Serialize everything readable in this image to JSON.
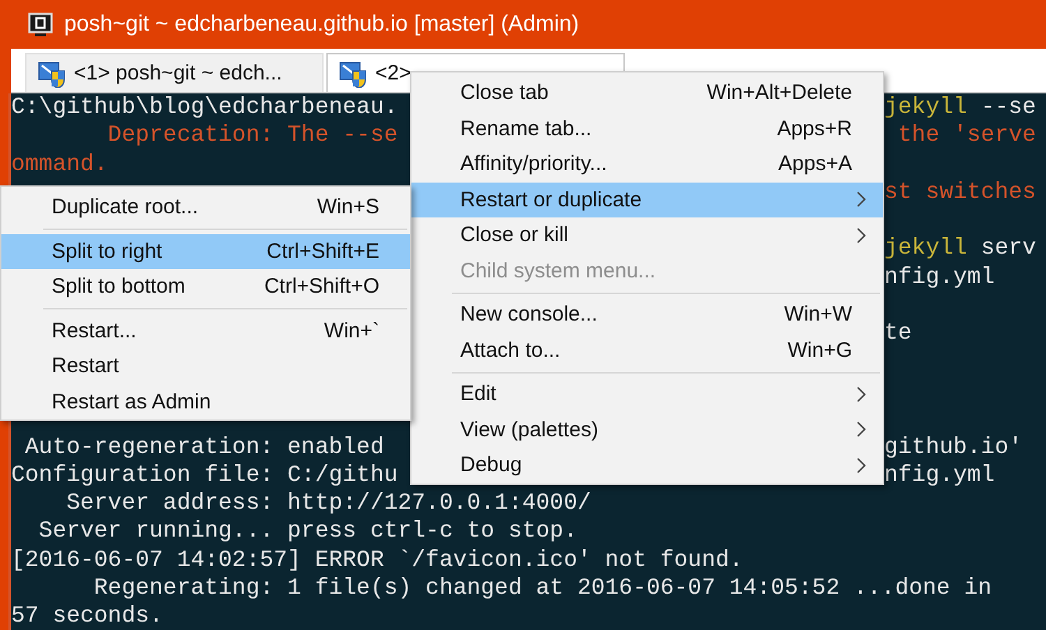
{
  "window": {
    "title": "posh~git ~ edcharbeneau.github.io [master] (Admin)"
  },
  "tabs": [
    {
      "label": "<1> posh~git ~ edch...",
      "selected": false
    },
    {
      "label": "<2>",
      "selected": true
    }
  ],
  "terminal": {
    "lines": [
      {
        "kind": "text",
        "left": [
          {
            "text": "C:\\github\\blog\\edcharbeneau.",
            "kind": "plain"
          }
        ],
        "right": [
          {
            "text": "jekyll",
            "kind": "command"
          },
          {
            "text": " --se",
            "kind": "plain"
          }
        ]
      },
      {
        "kind": "text",
        "left": [
          {
            "text": "       Deprecation: The --se",
            "kind": "warning"
          }
        ],
        "right": [
          {
            "text": " the 'serve",
            "kind": "warning"
          }
        ]
      },
      {
        "kind": "text",
        "left": [
          {
            "text": "ommand.",
            "kind": "warning"
          }
        ]
      },
      {
        "kind": "text",
        "right": [
          {
            "text": "st switches",
            "kind": "warning"
          }
        ]
      },
      {
        "kind": "blank"
      },
      {
        "kind": "text",
        "right": [
          {
            "text": "jekyll",
            "kind": "command"
          },
          {
            "text": " serv",
            "kind": "plain"
          }
        ]
      },
      {
        "kind": "text",
        "right": [
          {
            "text": "nfig.yml",
            "kind": "plain"
          }
        ]
      },
      {
        "kind": "blank"
      },
      {
        "kind": "text",
        "right": [
          {
            "text": "te",
            "kind": "plain"
          }
        ]
      },
      {
        "kind": "blank"
      },
      {
        "kind": "blank"
      },
      {
        "kind": "blank"
      },
      {
        "kind": "text",
        "left": [
          {
            "text": " Auto-regeneration: enabled",
            "kind": "plain"
          }
        ],
        "right": [
          {
            "text": "github.io'",
            "kind": "plain"
          }
        ]
      },
      {
        "kind": "text",
        "left": [
          {
            "text": "Configuration file: C:/githu",
            "kind": "plain"
          }
        ],
        "right": [
          {
            "text": "nfig.yml",
            "kind": "plain"
          }
        ]
      },
      {
        "kind": "text",
        "left": [
          {
            "text": "    Server address: http://127.0.0.1:4000/",
            "kind": "plain"
          }
        ]
      },
      {
        "kind": "text",
        "left": [
          {
            "text": "  Server running... press ctrl-c to stop.",
            "kind": "plain"
          }
        ]
      },
      {
        "kind": "text",
        "left": [
          {
            "text": "[2016-06-07 14:02:57] ERROR `/favicon.ico' not found.",
            "kind": "plain"
          }
        ]
      },
      {
        "kind": "text",
        "left": [
          {
            "text": "      Regenerating: 1 file(s) changed at 2016-06-07 14:05:52 ...done in",
            "kind": "plain"
          }
        ]
      },
      {
        "kind": "text",
        "left": [
          {
            "text": "57 seconds.",
            "kind": "plain"
          }
        ]
      }
    ]
  },
  "context_menu": {
    "items": [
      {
        "kind": "item",
        "label": "Close tab",
        "shortcut": "Win+Alt+Delete",
        "selected": false,
        "disabled": false
      },
      {
        "kind": "item",
        "label": "Rename tab...",
        "shortcut": "Apps+R",
        "selected": false,
        "disabled": false
      },
      {
        "kind": "item",
        "label": "Affinity/priority...",
        "shortcut": "Apps+A",
        "selected": false,
        "disabled": false
      },
      {
        "kind": "submenu",
        "label": "Restart or duplicate",
        "selected": true,
        "disabled": false
      },
      {
        "kind": "submenu",
        "label": "Close or kill",
        "selected": false,
        "disabled": false
      },
      {
        "kind": "item",
        "label": "Child system menu...",
        "selected": false,
        "disabled": true
      },
      {
        "kind": "separator"
      },
      {
        "kind": "item",
        "label": "New console...",
        "shortcut": "Win+W",
        "selected": false,
        "disabled": false
      },
      {
        "kind": "item",
        "label": "Attach to...",
        "shortcut": "Win+G",
        "selected": false,
        "disabled": false
      },
      {
        "kind": "separator"
      },
      {
        "kind": "submenu",
        "label": "Edit",
        "selected": false,
        "disabled": false
      },
      {
        "kind": "submenu",
        "label": "View (palettes)",
        "selected": false,
        "disabled": false
      },
      {
        "kind": "submenu",
        "label": "Debug",
        "selected": false,
        "disabled": false
      }
    ]
  },
  "submenu": {
    "items": [
      {
        "kind": "item",
        "label": "Duplicate root...",
        "shortcut": "Win+S",
        "selected": false,
        "disabled": false
      },
      {
        "kind": "separator"
      },
      {
        "kind": "item",
        "label": "Split to right",
        "shortcut": "Ctrl+Shift+E",
        "selected": true,
        "disabled": false
      },
      {
        "kind": "item",
        "label": "Split to bottom",
        "shortcut": "Ctrl+Shift+O",
        "selected": false,
        "disabled": false
      },
      {
        "kind": "separator"
      },
      {
        "kind": "item",
        "label": "Restart...",
        "shortcut": "Win+`",
        "selected": false,
        "disabled": false
      },
      {
        "kind": "item",
        "label": "Restart",
        "selected": false,
        "disabled": false
      },
      {
        "kind": "item",
        "label": "Restart as Admin",
        "selected": false,
        "disabled": false
      }
    ]
  }
}
